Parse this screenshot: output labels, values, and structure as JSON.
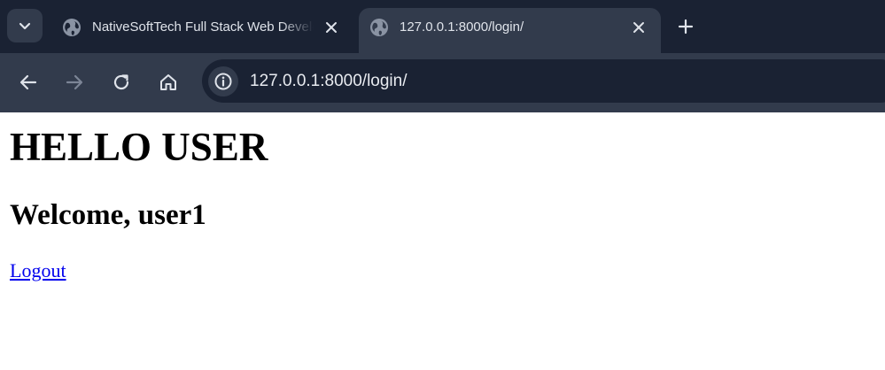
{
  "browser": {
    "tabs": [
      {
        "title": "NativeSoftTech Full Stack Web Developer",
        "favicon": "globe-icon",
        "active": false
      },
      {
        "title": "127.0.0.1:8000/login/",
        "favicon": "globe-icon",
        "active": true
      }
    ],
    "address_bar": {
      "url": "127.0.0.1:8000/login/"
    },
    "icons": {
      "tab_search": "chevron-down-icon",
      "tab_close": "close-icon",
      "new_tab": "plus-icon",
      "back": "back-arrow-icon",
      "forward": "forward-arrow-icon",
      "reload": "reload-icon",
      "home": "home-icon",
      "site_info": "info-icon"
    },
    "colors": {
      "tabstrip_bg": "#1a2233",
      "toolbar_bg": "#323b4c",
      "link": "#0000ee"
    }
  },
  "page": {
    "heading": "HELLO USER",
    "welcome": "Welcome, user1",
    "logout_link": "Logout"
  }
}
